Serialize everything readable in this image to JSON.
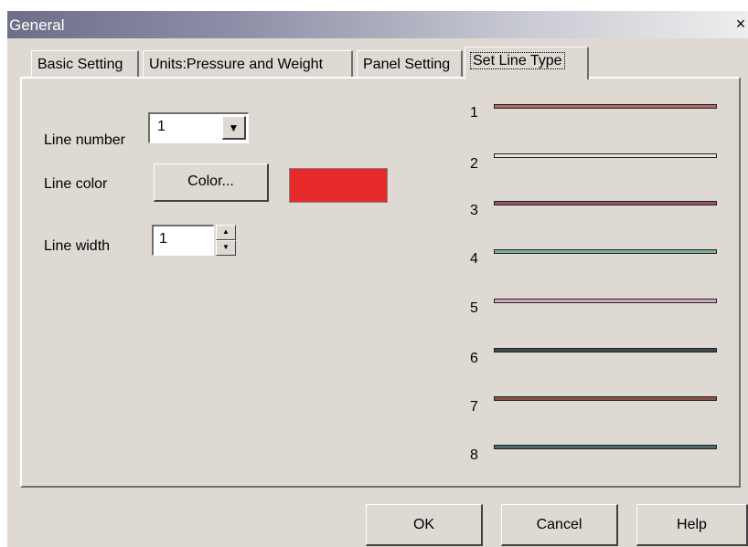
{
  "window": {
    "title": "General",
    "close_glyph": "×"
  },
  "tabs": [
    {
      "label": "Basic Setting",
      "active": false
    },
    {
      "label": "Units:Pressure and Weight",
      "active": false
    },
    {
      "label": "Panel Setting",
      "active": false
    },
    {
      "label": "Set Line Type",
      "active": true
    }
  ],
  "form": {
    "line_number_label": "Line number",
    "line_number_value": "1",
    "line_color_label": "Line color",
    "color_button_label": "Color...",
    "current_color": "#e8292a",
    "line_width_label": "Line width",
    "line_width_value": "1"
  },
  "line_types": [
    {
      "number": "1",
      "color": "#b06e62"
    },
    {
      "number": "2",
      "color": "#e7e5da"
    },
    {
      "number": "3",
      "color": "#96586a"
    },
    {
      "number": "4",
      "color": "#7fb09a"
    },
    {
      "number": "5",
      "color": "#d8a7c7"
    },
    {
      "number": "6",
      "color": "#3e4a4c"
    },
    {
      "number": "7",
      "color": "#8a5145"
    },
    {
      "number": "8",
      "color": "#4c6b6a"
    }
  ],
  "footer": {
    "ok_label": "OK",
    "cancel_label": "Cancel",
    "help_label": "Help"
  }
}
